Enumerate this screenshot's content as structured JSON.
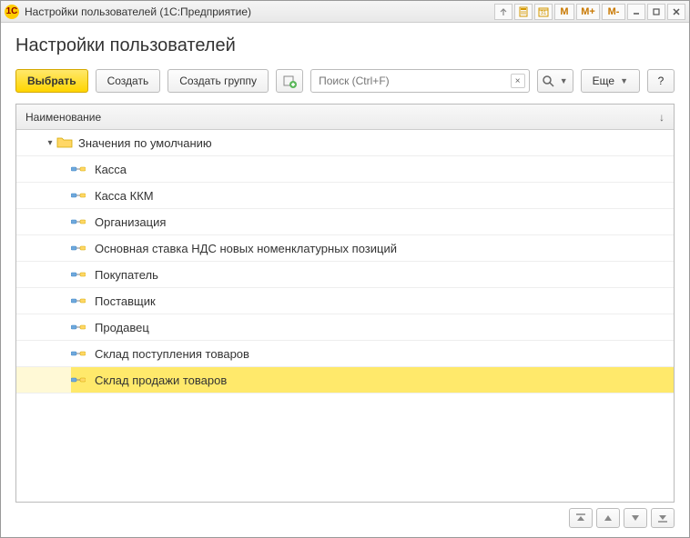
{
  "window": {
    "title": "Настройки пользователей  (1С:Предприятие)",
    "app_badge": "1C"
  },
  "titlebar_buttons": {
    "m": "M",
    "mplus": "M+",
    "mminus": "M-"
  },
  "page": {
    "title": "Настройки пользователей"
  },
  "toolbar": {
    "select": "Выбрать",
    "create": "Создать",
    "create_group": "Создать группу",
    "more": "Еще",
    "help": "?",
    "search_placeholder": "Поиск (Ctrl+F)"
  },
  "table": {
    "header": "Наименование",
    "group": "Значения по умолчанию",
    "items": [
      "Касса",
      "Касса ККМ",
      "Организация",
      "Основная ставка НДС новых номенклатурных позиций",
      "Покупатель",
      "Поставщик",
      "Продавец",
      "Склад поступления товаров",
      "Склад продажи товаров"
    ],
    "selected_index": 8
  }
}
